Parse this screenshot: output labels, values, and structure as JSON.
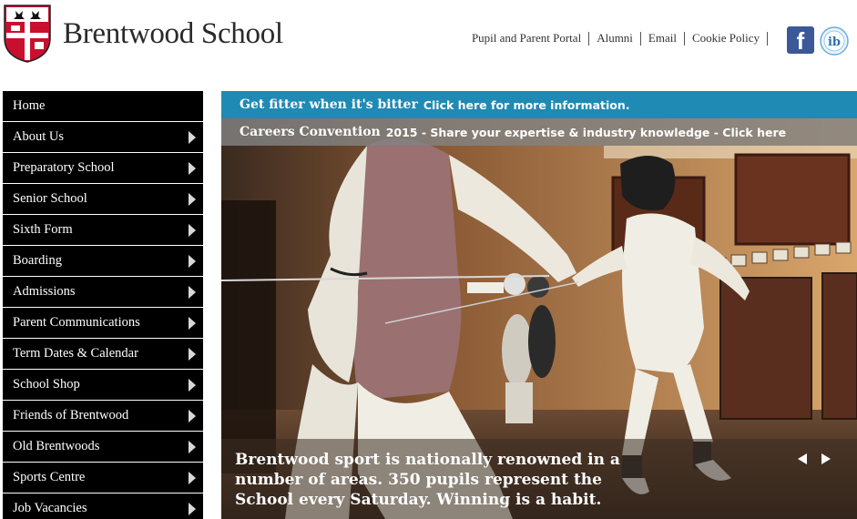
{
  "header": {
    "brand": "Brentwood School",
    "links": [
      "Pupil and Parent Portal",
      "Alumni",
      "Email",
      "Cookie Policy"
    ],
    "facebook_glyph": "f",
    "ib_glyph": "ib"
  },
  "nav": {
    "items": [
      {
        "label": "Home",
        "has_arrow": false
      },
      {
        "label": "About Us",
        "has_arrow": true
      },
      {
        "label": "Preparatory School",
        "has_arrow": true
      },
      {
        "label": "Senior School",
        "has_arrow": true
      },
      {
        "label": "Sixth Form",
        "has_arrow": true
      },
      {
        "label": "Boarding",
        "has_arrow": true
      },
      {
        "label": "Admissions",
        "has_arrow": true
      },
      {
        "label": "Parent Communications",
        "has_arrow": true
      },
      {
        "label": "Term Dates & Calendar",
        "has_arrow": true
      },
      {
        "label": "School Shop",
        "has_arrow": true
      },
      {
        "label": "Friends of Brentwood",
        "has_arrow": true
      },
      {
        "label": "Old Brentwoods",
        "has_arrow": true
      },
      {
        "label": "Sports Centre",
        "has_arrow": true
      },
      {
        "label": "Job Vacancies",
        "has_arrow": true
      }
    ]
  },
  "hero": {
    "banner1": {
      "bold": "Get fitter when it's bitter",
      "text": "Click here for more information."
    },
    "banner2": {
      "bold": "Careers Convention",
      "text": "2015 - Share your expertise & industry knowledge - Click here"
    },
    "caption": "Brentwood sport is nationally renowned in a number of areas. 350 pupils represent the School every Saturday. Winning is a habit."
  },
  "colors": {
    "banner1": "#1f8ab4",
    "nav_bg": "#000000",
    "facebook": "#3b5998"
  },
  "icons": [
    "school-crest-icon",
    "facebook-icon",
    "ib-logo-icon",
    "arrow-right-icon",
    "prev-arrow-icon",
    "next-arrow-icon"
  ]
}
